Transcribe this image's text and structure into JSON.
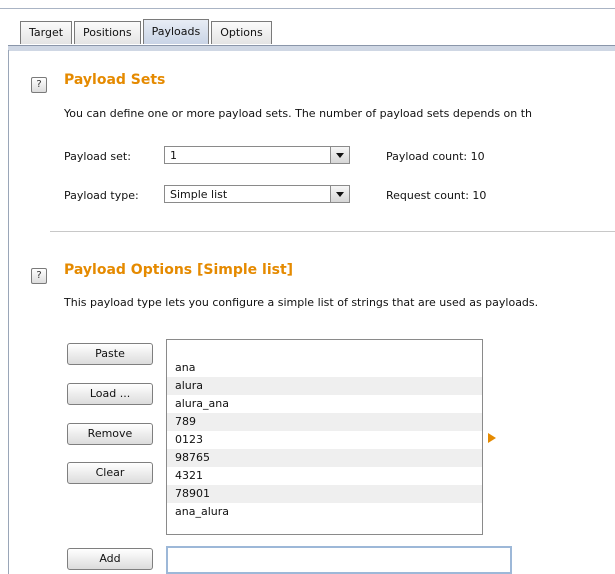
{
  "tabs": [
    {
      "label": "Target",
      "active": false
    },
    {
      "label": "Positions",
      "active": false
    },
    {
      "label": "Payloads",
      "active": true
    },
    {
      "label": "Options",
      "active": false
    }
  ],
  "help_glyph": "?",
  "payload_sets": {
    "title": "Payload Sets",
    "description": "You can define one or more payload sets. The number of payload sets depends on th",
    "payload_set_label": "Payload set:",
    "payload_set_value": "1",
    "payload_type_label": "Payload type:",
    "payload_type_value": "Simple list",
    "payload_count_label": "Payload count:",
    "payload_count_value": "10",
    "request_count_label": "Request count:",
    "request_count_value": "10"
  },
  "payload_options": {
    "title": "Payload Options [Simple list]",
    "description": "This payload type lets you configure a simple list of strings that are used as payloads.",
    "buttons": {
      "paste": "Paste",
      "load": "Load ...",
      "remove": "Remove",
      "clear": "Clear",
      "add": "Add"
    },
    "items": [
      "ana",
      "alura",
      "alura_ana",
      "789",
      "0123",
      "98765",
      "4321",
      "78901",
      "ana_alura"
    ],
    "add_value": ""
  },
  "colors": {
    "accent": "#e58a00",
    "tab_active": "#c9d4e6"
  },
  "icons": {
    "help": "question-mark-icon",
    "dropdown": "chevron-down-icon",
    "expand": "triangle-right-icon"
  }
}
